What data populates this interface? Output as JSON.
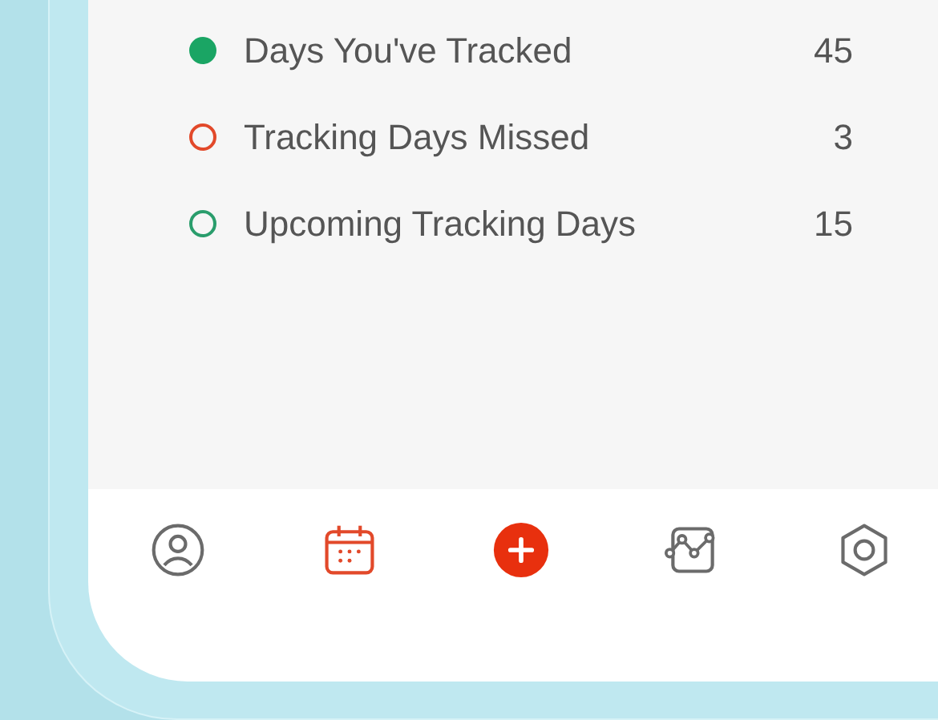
{
  "legend": [
    {
      "kind": "filled",
      "color": "#1aa564",
      "label": "Days You've Tracked",
      "count": "45"
    },
    {
      "kind": "ring",
      "color": "#e2492a",
      "label": "Tracking Days Missed",
      "count": "3"
    },
    {
      "kind": "ring",
      "color": "#2a9d6c",
      "label": "Upcoming Tracking Days",
      "count": "15"
    }
  ],
  "tab_bar": [
    {
      "kind": "profile",
      "selected": false
    },
    {
      "kind": "calendar",
      "selected": true
    },
    {
      "kind": "add"
    },
    {
      "kind": "chart",
      "selected": false
    },
    {
      "kind": "settings",
      "selected": false
    }
  ]
}
